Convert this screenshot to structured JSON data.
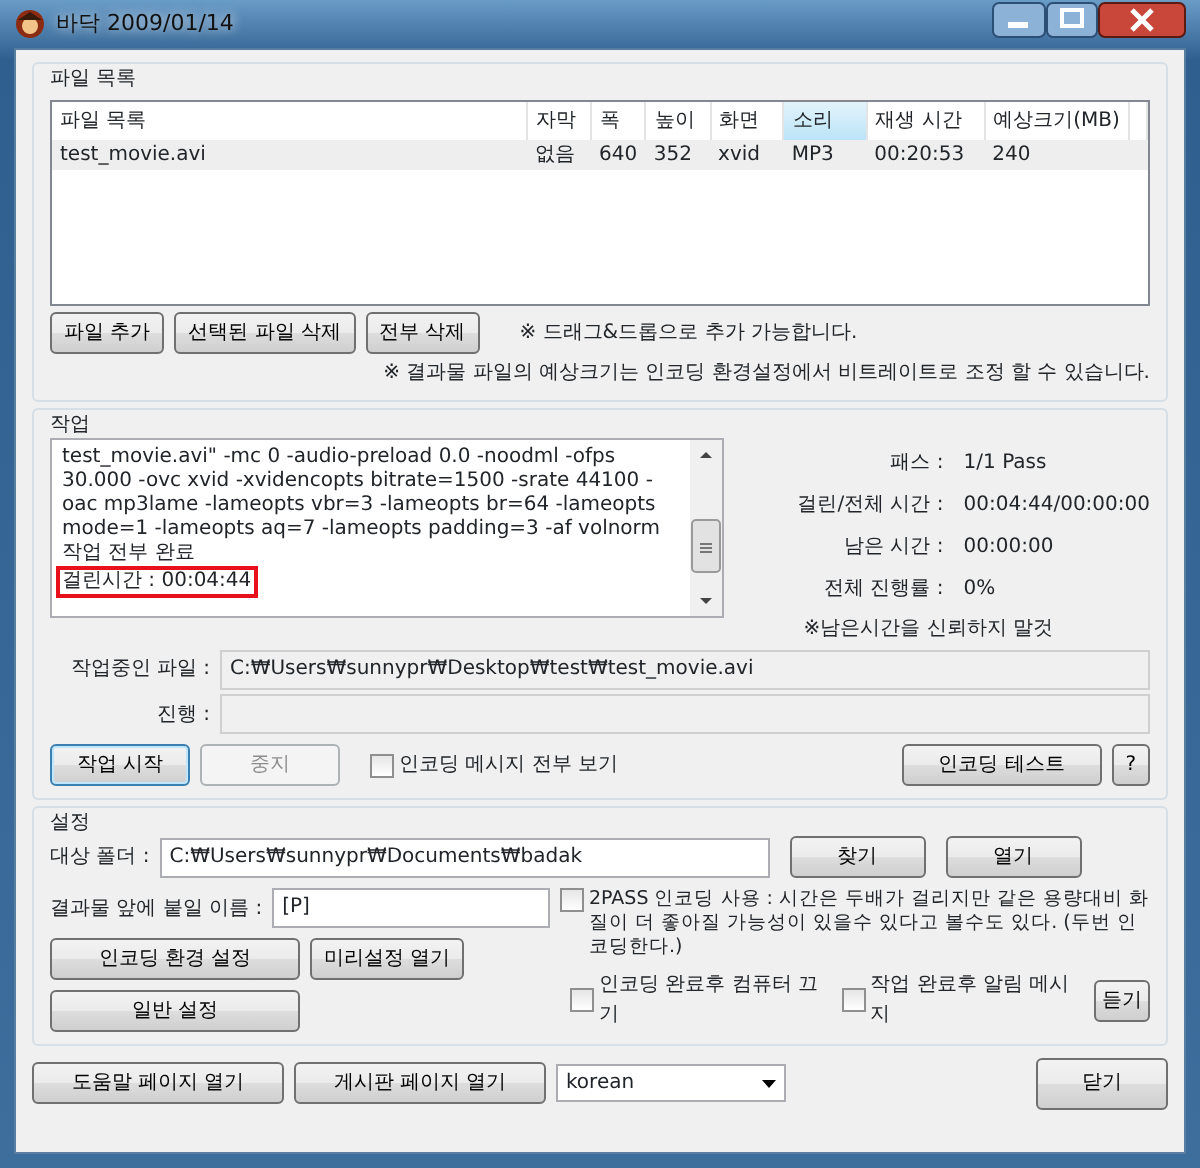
{
  "window": {
    "title": "바닥 2009/01/14"
  },
  "file_list": {
    "title": "파일 목록",
    "columns": [
      {
        "label": "파일 목록",
        "selected": false
      },
      {
        "label": "자막",
        "selected": false
      },
      {
        "label": "폭",
        "selected": false
      },
      {
        "label": "높이",
        "selected": false
      },
      {
        "label": "화면",
        "selected": false
      },
      {
        "label": "소리",
        "selected": true
      },
      {
        "label": "재생 시간",
        "selected": false
      },
      {
        "label": "예상크기(MB)",
        "selected": false
      }
    ],
    "rows": [
      {
        "cells": [
          "test_movie.avi",
          "없음",
          "640",
          "352",
          "xvid",
          "MP3",
          "00:20:53",
          "240"
        ],
        "selected": true
      }
    ],
    "buttons": [
      "파일 추가",
      "선택된 파일 삭제",
      "전부 삭제"
    ],
    "hint": "※ 드래그&드롭으로 추가 가능합니다.",
    "note": "※ 결과물 파일의 예상크기는 인코딩 환경설정에서 비트레이트로 조정 할 수 있습니다."
  },
  "job": {
    "title": "작업",
    "log": [
      {
        "text": "test_movie.avi\" -mc 0 -audio-preload 0.0 -noodml -ofps 30.000 -ovc xvid -xvidencopts bitrate=1500 -srate 44100 -oac mp3lame -lameopts vbr=3  -lameopts br=64 -lameopts mode=1 -lameopts aq=7 -lameopts padding=3 -af volnorm",
        "highlighted": false
      },
      {
        "text": "작업 전부 완료",
        "highlighted": false
      },
      {
        "text": "걸린시간 : 00:04:44",
        "highlighted": true
      }
    ],
    "stats": [
      {
        "label": "패스 :",
        "value": "1/1 Pass"
      },
      {
        "label": "걸린/전체 시간 :",
        "value": "00:04:44/00:00:00"
      },
      {
        "label": "남은 시간 :",
        "value": "00:00:00"
      },
      {
        "label": "전체 진행률 :",
        "value": "0%"
      }
    ],
    "warning": "※남은시간을 신뢰하지 말것",
    "current_file": {
      "label": "작업중인 파일 :",
      "value": "C:₩Users₩sunnypr₩Desktop₩test₩test_movie.avi"
    },
    "progress": {
      "label": "진행 :",
      "level": 0
    },
    "buttons": [
      {
        "label": "작업 시작",
        "disabled": false,
        "default": true
      },
      {
        "label": "중지",
        "disabled": true,
        "default": false
      }
    ],
    "show_all_messages": {
      "label": "인코딩 메시지 전부 보기",
      "checked": false
    },
    "test_button": "인코딩 테스트",
    "help_button": "?"
  },
  "settings": {
    "title": "설정",
    "target_folder": {
      "label": "대상 폴더 :",
      "value": "C:₩Users₩sunnypr₩Documents₩badak"
    },
    "browse_button": "찾기",
    "open_button": "열기",
    "prefix": {
      "label": "결과물 앞에 붙일 이름 :",
      "value": "[P]"
    },
    "two_pass": {
      "label": "2PASS 인코딩 사용 : 시간은 두배가 걸리지만 같은 용량대비 화질이 더 좋아질 가능성이 있을수 있다고 볼수도 있다. (두번 인코딩한다.)",
      "checked": false
    },
    "encode_settings_button": "인코딩 환경 설정",
    "presets_button": "미리설정 열기",
    "general_button": "일반 설정",
    "shutdown": {
      "label": "인코딩 완료후 컴퓨터 끄기",
      "checked": false
    },
    "notify": {
      "label": "작업 완료후 알림 메시지",
      "checked": false
    },
    "listen_button": "듣기"
  },
  "footer": {
    "help_button": "도움말 페이지 열기",
    "board_button": "게시판 페이지 열기",
    "language": "korean",
    "close_button": "닫기"
  }
}
